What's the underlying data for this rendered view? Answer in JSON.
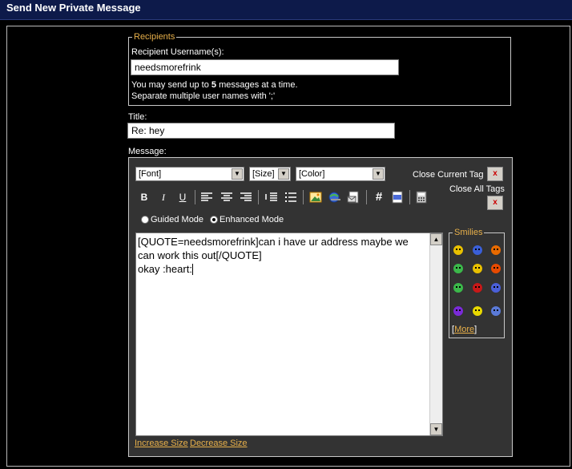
{
  "header": {
    "title": "Send New Private Message"
  },
  "recipients": {
    "legend": "Recipients",
    "username_label": "Recipient Username(s):",
    "username_value": "needsmorefrink",
    "hint_line1_prefix": "You may send up to ",
    "hint_line1_count": "5",
    "hint_line1_suffix": " messages at a time.",
    "hint_line2": "Separate multiple user names with ';'"
  },
  "title_field": {
    "label": "Title:",
    "value": "Re: hey"
  },
  "message": {
    "label": "Message:",
    "font_select": "[Font]",
    "size_select": "[Size]",
    "color_select": "[Color]",
    "close_current_tag": "Close Current Tag",
    "close_all_tags": "Close All Tags",
    "close_x": "x",
    "bold": "B",
    "italic": "I",
    "underline": "U",
    "hash": "#",
    "guided_mode": "Guided Mode",
    "enhanced_mode": "Enhanced Mode",
    "enhanced_selected": true,
    "body": "[QUOTE=needsmorefrink]can i have ur address maybe we can work this out[/QUOTE]\nokay :heart:",
    "increase_size": "Increase Size",
    "decrease_size": "Decrease Size"
  },
  "smilies": {
    "legend": "Smilies",
    "more": "More",
    "colors": [
      "#e8c000",
      "#3a5fd8",
      "#e86a00",
      "#3bb84a",
      "#e8c000",
      "#e84a00",
      "#3bb84a",
      "#c81818",
      "#4a5fd8",
      "#7a2ad8",
      "#e8d800",
      "#5a7ad8"
    ]
  },
  "colors": {
    "accent": "#e8b04a",
    "header_bg": "#0d1a4a",
    "editor_bg": "#333333"
  }
}
